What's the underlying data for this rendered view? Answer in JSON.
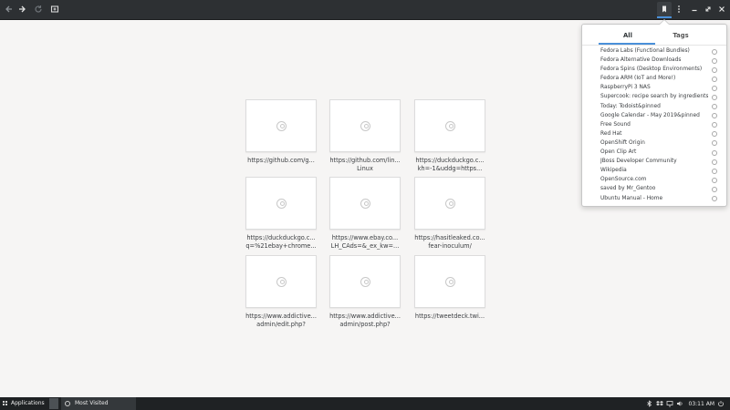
{
  "header": {
    "icons": [
      "back-icon",
      "forward-icon",
      "reload-icon",
      "new-tab-icon",
      "bookmark-icon",
      "menu-icon",
      "minimize-icon",
      "restore-icon",
      "close-icon"
    ]
  },
  "tiles": [
    {
      "line1": "https://github.com/g...",
      "line2": ""
    },
    {
      "line1": "https://github.com/lin...",
      "line2": "Linux"
    },
    {
      "line1": "https://duckduckgo.c...",
      "line2": "kh=-1&uddg=https..."
    },
    {
      "line1": "https://duckduckgo.c...",
      "line2": "q=%21ebay+chrome..."
    },
    {
      "line1": "https://www.ebay.co...",
      "line2": "LH_CAds=&_ex_kw=..."
    },
    {
      "line1": "https://hasitleaked.co...",
      "line2": "fear-inoculum/"
    },
    {
      "line1": "https://www.addictive...",
      "line2": "admin/edit.php?"
    },
    {
      "line1": "https://www.addictive...",
      "line2": "admin/post.php?"
    },
    {
      "line1": "https://tweetdeck.twi...",
      "line2": ""
    }
  ],
  "bookmarks": {
    "tabs": {
      "all": "All",
      "tags": "Tags"
    },
    "items": [
      "Fedora Labs (Functional Bundles)",
      "Fedora Alternative Downloads",
      "Fedora Spins (Desktop Environments)",
      "Fedora ARM (IoT and More!)",
      "RaspberryPi 3 NAS",
      "Supercook: recipe search by ingredients ...",
      "Today: Todoist&pinned",
      "Google Calendar - May 2019&pinned",
      "Free Sound",
      "Red Hat",
      "OpenShift Origin",
      "Open Clip Art",
      "JBoss Developer Community",
      "Wikipedia",
      "OpenSource.com",
      "saved by Mr_Gentoo",
      "Ubuntu Manual - Home"
    ]
  },
  "taskbar": {
    "applications": "Applications",
    "task": "Most Visited",
    "clock": "03:11 AM"
  }
}
